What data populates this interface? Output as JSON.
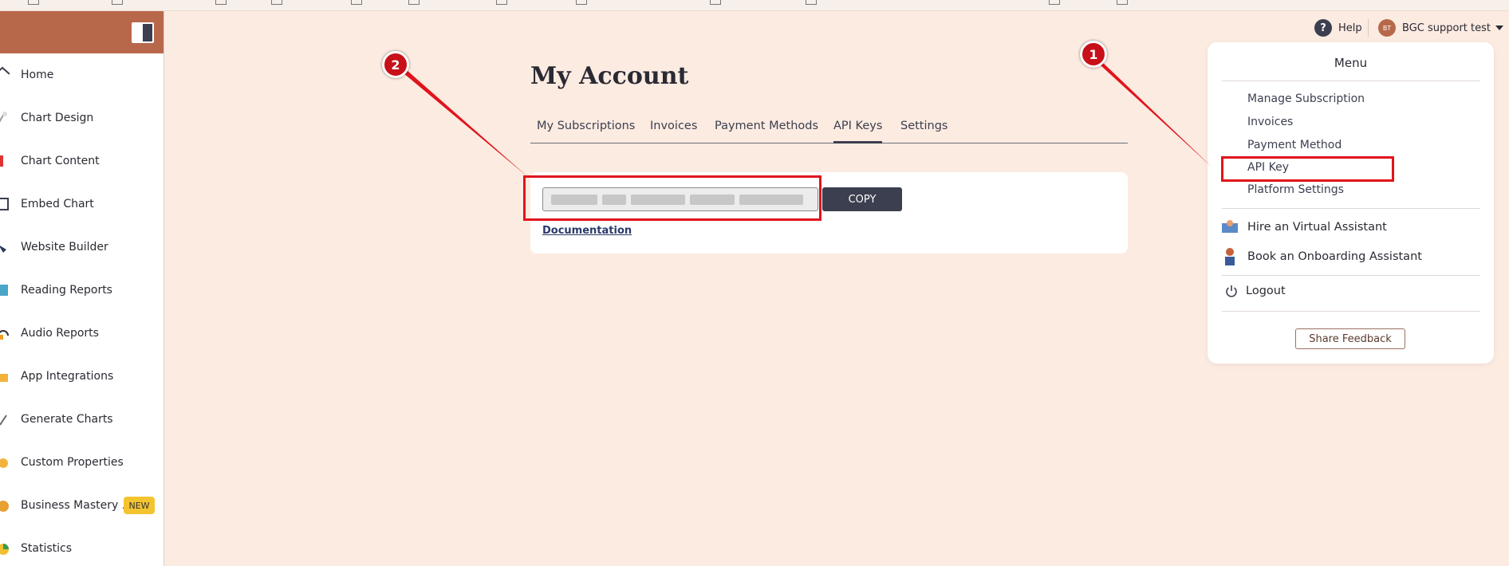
{
  "sidebar": {
    "items": [
      {
        "label": "Home",
        "icon": "home-icon"
      },
      {
        "label": "Chart Design",
        "icon": "chart-design-icon"
      },
      {
        "label": "Chart Content",
        "icon": "chart-content-icon"
      },
      {
        "label": "Embed Chart",
        "icon": "embed-icon"
      },
      {
        "label": "Website Builder",
        "icon": "website-builder-icon"
      },
      {
        "label": "Reading Reports",
        "icon": "reading-reports-icon"
      },
      {
        "label": "Audio Reports",
        "icon": "headphones-icon"
      },
      {
        "label": "App Integrations",
        "icon": "integrations-icon"
      },
      {
        "label": "Generate Charts",
        "icon": "generate-charts-icon"
      },
      {
        "label": "Custom Properties",
        "icon": "custom-properties-icon"
      },
      {
        "label": "Business Mastery ...",
        "icon": "business-mastery-icon",
        "badge": "NEW"
      },
      {
        "label": "Statistics",
        "icon": "statistics-icon"
      }
    ]
  },
  "header": {
    "help_label": "Help",
    "avatar_initials": "BT",
    "user_label": "BGC support test"
  },
  "main": {
    "title": "My Account",
    "tabs": [
      {
        "label": "My Subscriptions"
      },
      {
        "label": "Invoices"
      },
      {
        "label": "Payment Methods"
      },
      {
        "label": "API Keys",
        "active": true
      },
      {
        "label": "Settings"
      }
    ],
    "copy_label": "COPY",
    "documentation_label": "Documentation"
  },
  "menu": {
    "title": "Menu",
    "items": [
      {
        "label": "Manage Subscription"
      },
      {
        "label": "Invoices"
      },
      {
        "label": "Payment Method"
      },
      {
        "label": "API Key"
      },
      {
        "label": "Platform Settings"
      }
    ],
    "assistants": [
      {
        "label": "Hire an Virtual Assistant",
        "icon": "virtual-assistant-icon"
      },
      {
        "label": "Book an Onboarding Assistant",
        "icon": "onboarding-assistant-icon"
      }
    ],
    "logout_label": "Logout",
    "share_feedback_label": "Share Feedback"
  },
  "annotations": {
    "callout_1": "1",
    "callout_2": "2"
  },
  "colors": {
    "background": "#fcebe1",
    "sidebar_header": "#b8684a",
    "dark_accent": "#3b3f4f",
    "annotation_red": "#e0141c",
    "new_badge": "#f4c430"
  }
}
